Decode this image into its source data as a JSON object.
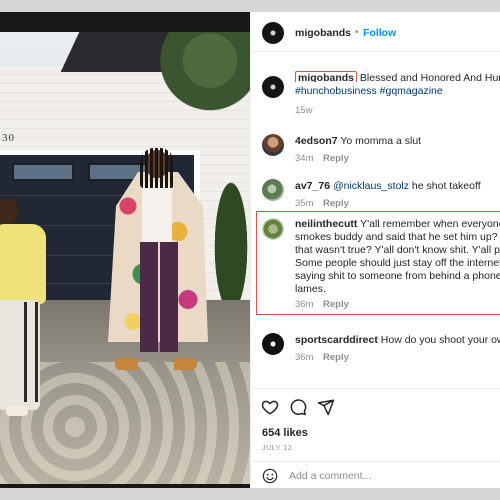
{
  "post": {
    "username": "migobands",
    "follow_label": "Follow",
    "separator": "•"
  },
  "caption": {
    "username": "migobands",
    "text": " Blessed and Honored And Humble",
    "hashtags": [
      "#hunchobusiness",
      "#gqmagazine"
    ],
    "emoji": "✌",
    "age": "15w"
  },
  "photo": {
    "house_number": "30"
  },
  "comments": [
    {
      "username": "4edson7",
      "text": "Yo momma a slut",
      "age": "34m",
      "reply": "Reply"
    },
    {
      "username": "av7_76",
      "mention": "@nicklaus_stolz",
      "text": " he shot takeoff",
      "age": "35m",
      "reply": "Reply"
    },
    {
      "username": "neilinthecutt",
      "lines": [
        "Y'all remember when everyone lo",
        "smokes buddy and said that he set him up? Ju",
        "that wasn't true? Y'all don't know shit. Y'all pp",
        "Some people should just stay off the internet.",
        "saying shit to someone from behind a phone. A",
        "lames."
      ],
      "age": "36m",
      "reply": "Reply"
    },
    {
      "username": "sportscarddirect",
      "text": "How do you shoot your own",
      "age": "36m",
      "reply": "Reply"
    }
  ],
  "actions": {
    "likes": "654 likes",
    "date": "JULY 12",
    "comment_placeholder": "Add a comment...",
    "icons": [
      "heart-icon",
      "comment-icon",
      "share-icon",
      "emoji-icon"
    ]
  },
  "colors": {
    "follow_blue": "#0095f6",
    "highlight_red": "#d9534f",
    "hashtag": "#00376b",
    "muted": "#8e8e8e"
  }
}
